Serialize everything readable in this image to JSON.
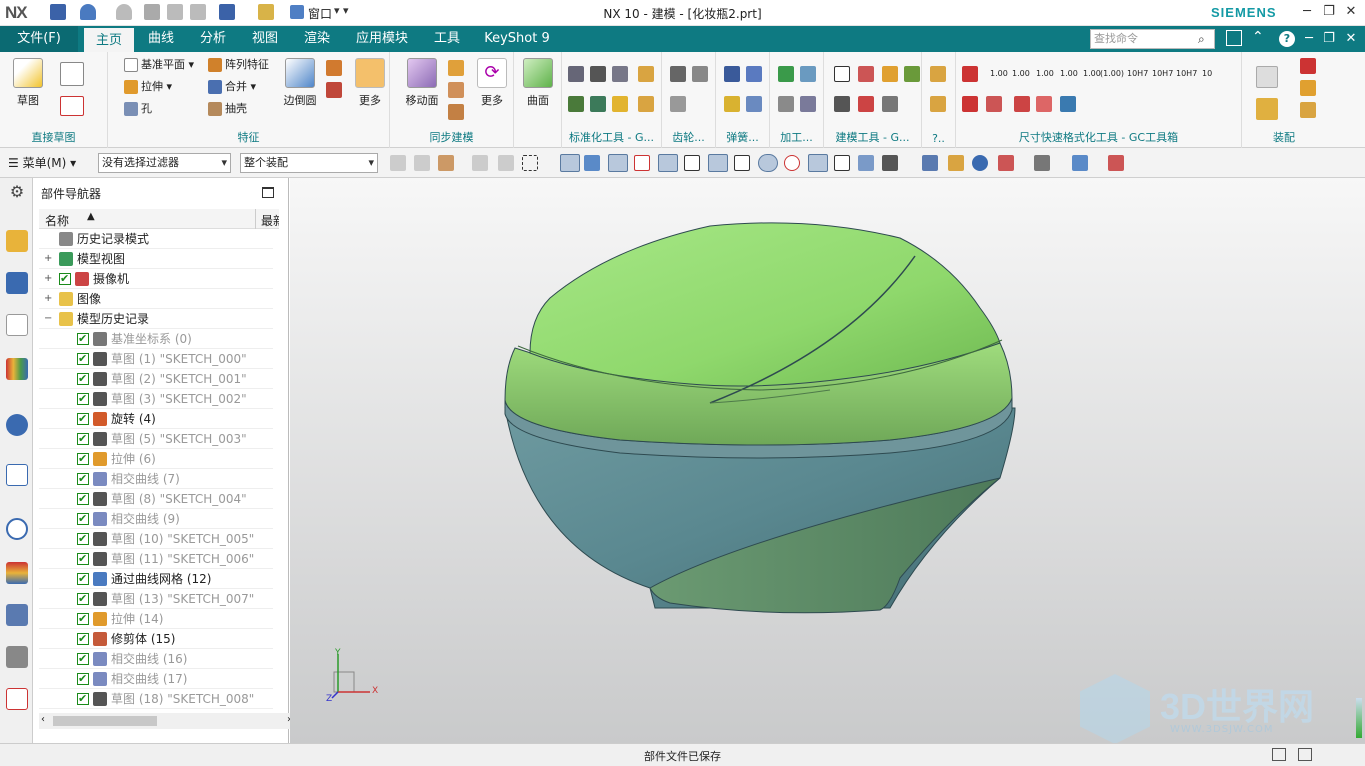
{
  "titlebar": {
    "logo": "NX",
    "title": "NX 10 - 建模 - [化妆瓶2.prt]",
    "window_menu": "窗口",
    "brand": "SIEMENS"
  },
  "tabs": {
    "file": "文件(F)",
    "items": [
      "主页",
      "曲线",
      "分析",
      "视图",
      "渲染",
      "应用模块",
      "工具",
      "KeyShot 9"
    ],
    "active": "主页",
    "search_placeholder": "查找命令"
  },
  "ribbon": {
    "sketch": {
      "label": "草图",
      "group": "直接草图"
    },
    "feature": {
      "datum_plane": "基准平面",
      "pattern_feature": "阵列特征",
      "extrude": "拉伸",
      "unite": "合并",
      "hole": "孔",
      "shell": "抽壳",
      "edge_blend": "边倒圆",
      "more": "更多",
      "group": "特征"
    },
    "sync": {
      "move_face": "移动面",
      "more": "更多",
      "group": "同步建模"
    },
    "surface": {
      "label": "曲面"
    },
    "group_labels": [
      "标准化工具 - G...",
      "齿轮...",
      "弹簧...",
      "加工...",
      "建模工具 - G...",
      "?..",
      "尺寸快速格式化工具 - GC工具箱",
      "装配"
    ],
    "dim_labels": [
      "1.00",
      "1.00",
      "1.00",
      "1.00",
      "1.00",
      "(1.00)",
      "10H7",
      "10H7",
      "10H7",
      "10"
    ]
  },
  "toolbar2": {
    "menu": "菜单(M)",
    "filter": "没有选择过滤器",
    "scope": "整个装配"
  },
  "navigator": {
    "title": "部件导航器",
    "col_name": "名称",
    "col_latest": "最新",
    "rows": [
      {
        "text": "历史记录模式",
        "level": 0,
        "icon": "history-mode-icon",
        "suppressed": false,
        "check": false,
        "expand": ""
      },
      {
        "text": "模型视图",
        "level": 0,
        "icon": "model-views-icon",
        "suppressed": false,
        "check": false,
        "expand": "+"
      },
      {
        "text": "摄像机",
        "level": 0,
        "icon": "camera-icon",
        "suppressed": false,
        "check": true,
        "expand": "+"
      },
      {
        "text": "图像",
        "level": 0,
        "icon": "images-folder-icon",
        "suppressed": false,
        "check": false,
        "expand": "+"
      },
      {
        "text": "模型历史记录",
        "level": 0,
        "icon": "model-history-folder-icon",
        "suppressed": false,
        "check": false,
        "expand": "−"
      },
      {
        "text": "基准坐标系 (0)",
        "level": 1,
        "icon": "datum-csys-icon",
        "suppressed": true,
        "check": true,
        "expand": ""
      },
      {
        "text": "草图 (1) \"SKETCH_000\"",
        "level": 1,
        "icon": "sketch-icon",
        "suppressed": true,
        "check": true,
        "expand": ""
      },
      {
        "text": "草图 (2) \"SKETCH_001\"",
        "level": 1,
        "icon": "sketch-icon",
        "suppressed": true,
        "check": true,
        "expand": ""
      },
      {
        "text": "草图 (3) \"SKETCH_002\"",
        "level": 1,
        "icon": "sketch-icon",
        "suppressed": true,
        "check": true,
        "expand": ""
      },
      {
        "text": "旋转 (4)",
        "level": 1,
        "icon": "revolve-icon",
        "suppressed": false,
        "check": true,
        "expand": ""
      },
      {
        "text": "草图 (5) \"SKETCH_003\"",
        "level": 1,
        "icon": "sketch-icon",
        "suppressed": true,
        "check": true,
        "expand": ""
      },
      {
        "text": "拉伸 (6)",
        "level": 1,
        "icon": "extrude-icon",
        "suppressed": true,
        "check": true,
        "expand": ""
      },
      {
        "text": "相交曲线 (7)",
        "level": 1,
        "icon": "intersection-curve-icon",
        "suppressed": true,
        "check": true,
        "expand": ""
      },
      {
        "text": "草图 (8) \"SKETCH_004\"",
        "level": 1,
        "icon": "sketch-icon",
        "suppressed": true,
        "check": true,
        "expand": ""
      },
      {
        "text": "相交曲线 (9)",
        "level": 1,
        "icon": "intersection-curve-icon",
        "suppressed": true,
        "check": true,
        "expand": ""
      },
      {
        "text": "草图 (10) \"SKETCH_005\"",
        "level": 1,
        "icon": "sketch-icon",
        "suppressed": true,
        "check": true,
        "expand": ""
      },
      {
        "text": "草图 (11) \"SKETCH_006\"",
        "level": 1,
        "icon": "sketch-icon",
        "suppressed": true,
        "check": true,
        "expand": ""
      },
      {
        "text": "通过曲线网格 (12)",
        "level": 1,
        "icon": "through-curve-mesh-icon",
        "suppressed": false,
        "check": true,
        "expand": ""
      },
      {
        "text": "草图 (13) \"SKETCH_007\"",
        "level": 1,
        "icon": "sketch-icon",
        "suppressed": true,
        "check": true,
        "expand": ""
      },
      {
        "text": "拉伸 (14)",
        "level": 1,
        "icon": "extrude-icon",
        "suppressed": true,
        "check": true,
        "expand": ""
      },
      {
        "text": "修剪体 (15)",
        "level": 1,
        "icon": "trim-body-icon",
        "suppressed": false,
        "check": true,
        "expand": ""
      },
      {
        "text": "相交曲线 (16)",
        "level": 1,
        "icon": "intersection-curve-icon",
        "suppressed": true,
        "check": true,
        "expand": ""
      },
      {
        "text": "相交曲线 (17)",
        "level": 1,
        "icon": "intersection-curve-icon",
        "suppressed": true,
        "check": true,
        "expand": ""
      },
      {
        "text": "草图 (18) \"SKETCH_008\"",
        "level": 1,
        "icon": "sketch-icon",
        "suppressed": true,
        "check": true,
        "expand": ""
      }
    ]
  },
  "viewport": {
    "triad": {
      "x": "X",
      "y": "Y",
      "z": "Z"
    },
    "watermark": {
      "text": "3D世界网",
      "url": "WWW.3DSJW.COM"
    }
  },
  "status": "部件文件已保存",
  "colors": {
    "teal": "#0e7a82",
    "green_top": "#8fdb6f",
    "blue_bottom": "#5d8c93"
  }
}
